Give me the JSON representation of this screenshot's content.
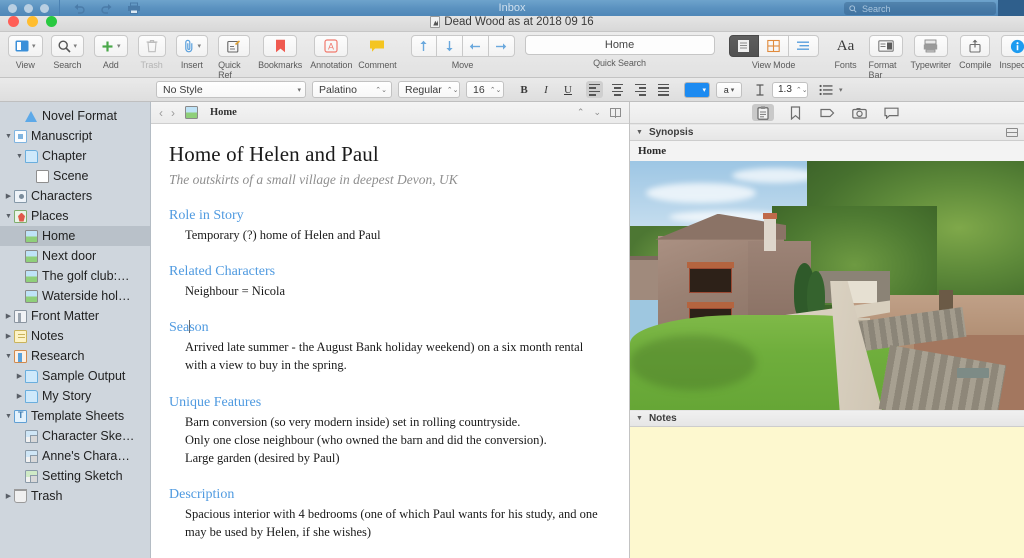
{
  "os_menubar": {
    "title": "Inbox",
    "search_placeholder": "Search",
    "undo_icon": "undo-icon",
    "redo_icon": "redo-icon",
    "print_icon": "print-icon"
  },
  "window": {
    "title": "Dead Wood as at 2018 09 16"
  },
  "toolbar": {
    "left_items": [
      {
        "label": "View",
        "icon": "view-panel-icon",
        "has_caret": true,
        "dim": false
      },
      {
        "label": "Search",
        "icon": "search-icon",
        "has_caret": true,
        "dim": false
      },
      {
        "label": "Add",
        "icon": "plus-icon",
        "has_caret": true,
        "dim": false
      },
      {
        "label": "Trash",
        "icon": "trash-icon",
        "has_caret": false,
        "dim": true
      },
      {
        "label": "Insert",
        "icon": "paperclip-icon",
        "has_caret": true,
        "dim": false
      },
      {
        "label": "Quick Ref",
        "icon": "quick-ref-icon",
        "has_caret": false,
        "dim": false
      },
      {
        "label": "Bookmarks",
        "icon": "bookmark-icon",
        "has_caret": false,
        "dim": false
      },
      {
        "label": "Annotation",
        "icon": "annotation-a-icon",
        "has_caret": false,
        "dim": false
      },
      {
        "label": "Comment",
        "icon": "comment-icon",
        "has_caret": false,
        "dim": false
      }
    ],
    "move": {
      "label": "Move",
      "buttons": [
        "move-up-icon",
        "move-down-icon",
        "move-left-icon",
        "move-right-icon"
      ]
    },
    "quick_search": {
      "label": "Quick Search",
      "value": "Home"
    },
    "view_mode": {
      "label": "View Mode",
      "modes": [
        "document-view-icon",
        "corkboard-view-icon",
        "outliner-view-icon"
      ],
      "selected_index": 0
    },
    "right_items": [
      {
        "label": "Fonts",
        "icon": "fonts-aa-icon"
      },
      {
        "label": "Format Bar",
        "icon": "format-bar-icon"
      },
      {
        "label": "Typewriter",
        "icon": "typewriter-icon"
      },
      {
        "label": "Compile",
        "icon": "compile-share-icon"
      },
      {
        "label": "Inspector",
        "icon": "inspector-info-icon"
      }
    ],
    "overflow_label": "»"
  },
  "format_bar": {
    "style": "No Style",
    "font_family": "Palatino",
    "font_weight": "Regular",
    "font_size": "16",
    "bold": "B",
    "italic": "I",
    "underline": "U",
    "align_selected_index": 0,
    "text_color": "#1d8bf1",
    "highlight_label": "a",
    "line_spacing": "1.3",
    "list_icon": "list-icon"
  },
  "binder": {
    "items": [
      {
        "label": "Novel Format",
        "indent": 1,
        "disclosure": "",
        "icon": "warning-triangle-icon",
        "selected": false
      },
      {
        "label": "Manuscript",
        "indent": 0,
        "disclosure": "▼",
        "icon": "manuscript-icon",
        "selected": false
      },
      {
        "label": "Chapter",
        "indent": 1,
        "disclosure": "▼",
        "icon": "folder-icon",
        "selected": false
      },
      {
        "label": "Scene",
        "indent": 2,
        "disclosure": "",
        "icon": "document-sheet-icon",
        "selected": false
      },
      {
        "label": "Characters",
        "indent": 0,
        "disclosure": "▶",
        "icon": "characters-icon",
        "selected": false
      },
      {
        "label": "Places",
        "indent": 0,
        "disclosure": "▼",
        "icon": "places-icon",
        "selected": false
      },
      {
        "label": "Home",
        "indent": 1,
        "disclosure": "",
        "icon": "photo-document-icon",
        "selected": true
      },
      {
        "label": "Next door",
        "indent": 1,
        "disclosure": "",
        "icon": "photo-document-icon",
        "selected": false
      },
      {
        "label": "The golf club:…",
        "indent": 1,
        "disclosure": "",
        "icon": "photo-document-icon",
        "selected": false
      },
      {
        "label": "Waterside hol…",
        "indent": 1,
        "disclosure": "",
        "icon": "photo-document-icon",
        "selected": false
      },
      {
        "label": "Front Matter",
        "indent": 0,
        "disclosure": "▶",
        "icon": "front-matter-icon",
        "selected": false
      },
      {
        "label": "Notes",
        "indent": 0,
        "disclosure": "▶",
        "icon": "notes-icon",
        "selected": false
      },
      {
        "label": "Research",
        "indent": 0,
        "disclosure": "▼",
        "icon": "research-icon",
        "selected": false
      },
      {
        "label": "Sample Output",
        "indent": 1,
        "disclosure": "▶",
        "icon": "folder-icon",
        "selected": false
      },
      {
        "label": "My Story",
        "indent": 1,
        "disclosure": "▶",
        "icon": "folder-icon",
        "selected": false
      },
      {
        "label": "Template Sheets",
        "indent": 0,
        "disclosure": "▼",
        "icon": "template-sheets-icon",
        "selected": false
      },
      {
        "label": "Character Ske…",
        "indent": 1,
        "disclosure": "",
        "icon": "character-sheet-icon",
        "selected": false
      },
      {
        "label": "Anne's Chara…",
        "indent": 1,
        "disclosure": "",
        "icon": "character-sheet-icon",
        "selected": false
      },
      {
        "label": "Setting Sketch",
        "indent": 1,
        "disclosure": "",
        "icon": "setting-sheet-icon",
        "selected": false
      },
      {
        "label": "Trash",
        "indent": 0,
        "disclosure": "▶",
        "icon": "trash-icon",
        "selected": false
      }
    ]
  },
  "editor": {
    "header": {
      "back_icon": "chevron-left-icon",
      "forward_icon": "chevron-right-icon",
      "doc_icon": "photo-document-icon",
      "title": "Home",
      "up_icon": "chevron-up-icon",
      "down_icon": "chevron-down-icon",
      "split_icon": "split-view-icon"
    },
    "document": {
      "title": "Home of Helen and Paul",
      "subtitle": "The outskirts of a small village in deepest Devon, UK",
      "sections": [
        {
          "heading": "Role in Story",
          "caret_after": 0,
          "paragraphs": [
            "Temporary (?) home of Helen and Paul"
          ]
        },
        {
          "heading": "Related Characters",
          "caret_after": 0,
          "paragraphs": [
            "Neighbour = Nicola"
          ]
        },
        {
          "heading": "Season",
          "caret_after": 3,
          "paragraphs": [
            "Arrived late summer - the August Bank holiday weekend) on a six month rental with a view to buy in the spring."
          ]
        },
        {
          "heading": "Unique Features",
          "caret_after": 0,
          "paragraphs": [
            "Barn conversion (so very modern inside) set in rolling countryside.",
            "Only one close neighbour (who owned the barn and did the conversion).",
            "Large garden (desired by Paul)"
          ]
        },
        {
          "heading": "Description",
          "caret_after": 0,
          "paragraphs": [
            "Spacious interior with 4 bedrooms (one of which Paul wants for his study, and one may be used by Helen, if she wishes)"
          ]
        }
      ]
    }
  },
  "inspector": {
    "tabs": [
      {
        "icon": "notecard-icon",
        "selected": true
      },
      {
        "icon": "bookmark-icon",
        "selected": false
      },
      {
        "icon": "tag-icon",
        "selected": false
      },
      {
        "icon": "camera-icon",
        "selected": false
      },
      {
        "icon": "comment-icon",
        "selected": false
      }
    ],
    "synopsis": {
      "header": "Synopsis",
      "toggle_icon": "disclosure-down-icon",
      "card_toggle_icon": "card-image-toggle-icon",
      "title": "Home",
      "image_alt": "stone-barn-conversion-photo"
    },
    "notes": {
      "header": "Notes",
      "toggle_icon": "disclosure-down-icon",
      "body": ""
    }
  }
}
